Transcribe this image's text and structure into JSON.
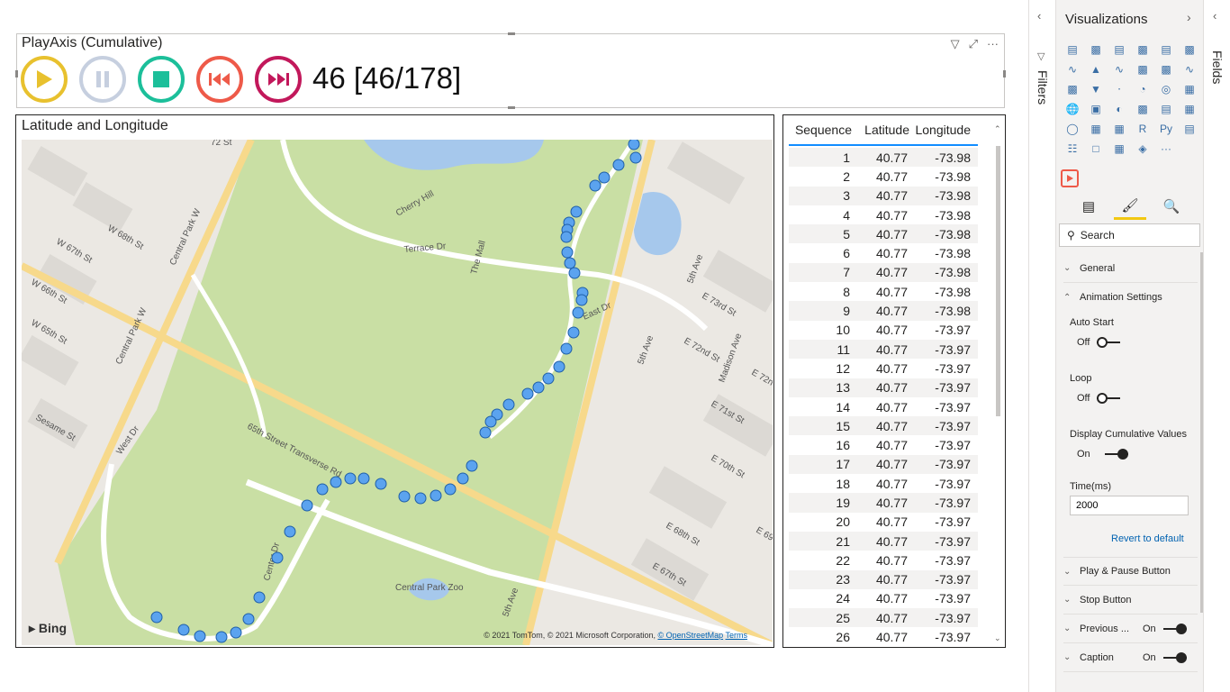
{
  "playaxis": {
    "title": "PlayAxis (Cumulative)",
    "counter": "46 [46/178]",
    "colors": {
      "play": "#e8c12e",
      "pause": "#c6cfdf",
      "stop": "#1cbf9a",
      "previous": "#ee5a49",
      "next": "#c2185b"
    }
  },
  "map": {
    "title": "Latitude and Longitude",
    "bing_label": "Bing",
    "copyright": "© 2021 TomTom, © 2021 Microsoft Corporation,",
    "osm_link": "© OpenStreetMap",
    "terms_link": "Terms",
    "street_labels": [
      "72 St",
      "Cherry Hill",
      "Terrace Dr",
      "The Mall",
      "W 68th St",
      "W 67th St",
      "W 66th St",
      "W 65th St",
      "Central Park W",
      "Central Park W",
      "Sesame St",
      "West Dr",
      "65th Street Transverse Rd",
      "Center Dr",
      "Central Park Zoo",
      "5th Ave",
      "5th Ave",
      "5th Ave",
      "E 73rd St",
      "E 72nd St",
      "Madison Ave",
      "E 71st St",
      "E 70th St",
      "E 69",
      "E 68th St",
      "E 67th St",
      "E 72n",
      "East Dr",
      "The Mall"
    ],
    "point_color": "#5ba3ef"
  },
  "table": {
    "headers": [
      "Sequence",
      "Latitude",
      "Longitude"
    ],
    "rows": [
      [
        "1",
        "40.77",
        "-73.98"
      ],
      [
        "2",
        "40.77",
        "-73.98"
      ],
      [
        "3",
        "40.77",
        "-73.98"
      ],
      [
        "4",
        "40.77",
        "-73.98"
      ],
      [
        "5",
        "40.77",
        "-73.98"
      ],
      [
        "6",
        "40.77",
        "-73.98"
      ],
      [
        "7",
        "40.77",
        "-73.98"
      ],
      [
        "8",
        "40.77",
        "-73.98"
      ],
      [
        "9",
        "40.77",
        "-73.98"
      ],
      [
        "10",
        "40.77",
        "-73.97"
      ],
      [
        "11",
        "40.77",
        "-73.97"
      ],
      [
        "12",
        "40.77",
        "-73.97"
      ],
      [
        "13",
        "40.77",
        "-73.97"
      ],
      [
        "14",
        "40.77",
        "-73.97"
      ],
      [
        "15",
        "40.77",
        "-73.97"
      ],
      [
        "16",
        "40.77",
        "-73.97"
      ],
      [
        "17",
        "40.77",
        "-73.97"
      ],
      [
        "18",
        "40.77",
        "-73.97"
      ],
      [
        "19",
        "40.77",
        "-73.97"
      ],
      [
        "20",
        "40.77",
        "-73.97"
      ],
      [
        "21",
        "40.77",
        "-73.97"
      ],
      [
        "22",
        "40.77",
        "-73.97"
      ],
      [
        "23",
        "40.77",
        "-73.97"
      ],
      [
        "24",
        "40.77",
        "-73.97"
      ],
      [
        "25",
        "40.77",
        "-73.97"
      ],
      [
        "26",
        "40.77",
        "-73.97"
      ]
    ]
  },
  "filters_rail": {
    "label": "Filters"
  },
  "fields_rail": {
    "label": "Fields"
  },
  "visualizations": {
    "title": "Visualizations",
    "search_placeholder": "Search",
    "sections": {
      "general": "General",
      "animation": "Animation Settings",
      "auto_start": "Auto Start",
      "auto_start_state": "Off",
      "loop": "Loop",
      "loop_state": "Off",
      "cumulative": "Display Cumulative Values",
      "cumulative_state": "On",
      "time_label": "Time(ms)",
      "time_value": "2000",
      "revert": "Revert to default",
      "play_pause": "Play & Pause Button",
      "stop": "Stop Button",
      "previous": "Previous ...",
      "previous_state": "On",
      "caption": "Caption",
      "caption_state": "On"
    }
  }
}
